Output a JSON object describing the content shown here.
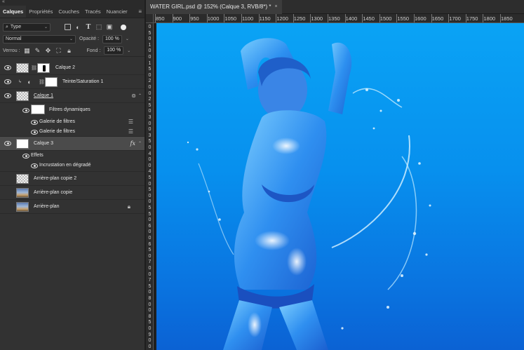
{
  "panel": {
    "collapse_glyph": "«",
    "tabs": [
      "Calques",
      "Propriétés",
      "Couches",
      "Tracés",
      "Nuancier"
    ],
    "menu_glyph": "≡",
    "filter": {
      "type_label": "Type"
    },
    "blend": {
      "mode": "Normal",
      "opacity_label": "Opacité :",
      "opacity_value": "100 %"
    },
    "lock": {
      "label": "Verrou :",
      "fill_label": "Fond :",
      "fill_value": "100 %"
    }
  },
  "layers": [
    {
      "name": "Calque 2",
      "visible": true,
      "thumb": "check",
      "mask": true
    },
    {
      "name": "Teinte/Saturation 1",
      "visible": true,
      "adjustment": true,
      "mask": true
    },
    {
      "name": "Calque 1",
      "visible": true,
      "smart": true,
      "underlined": true,
      "sub": [
        {
          "name": "Filtres dynamiques",
          "visible": true
        },
        {
          "name": "Galerie de filtres",
          "visible": true
        },
        {
          "name": "Galerie de filtres",
          "visible": true
        }
      ]
    },
    {
      "name": "Calque 3",
      "visible": true,
      "selected": true,
      "fx_glyph": "fx",
      "sub": [
        {
          "name": "Effets",
          "visible": true
        },
        {
          "name": "Incrustation en dégradé",
          "visible": true
        }
      ]
    },
    {
      "name": "Arrière-plan copie 2",
      "visible": false,
      "thumb": "check"
    },
    {
      "name": "Arrière-plan copie",
      "visible": false,
      "thumb": "photo"
    },
    {
      "name": "Arrière-plan",
      "visible": false,
      "thumb": "photo",
      "locked": true
    }
  ],
  "document": {
    "tab_title": "WATER GIRL.psd @ 152% (Calque 3, RVB/8*) *",
    "close_glyph": "×",
    "h_ruler": [
      "850",
      "900",
      "950",
      "1000",
      "1050",
      "1100",
      "1150",
      "1200",
      "1250",
      "1300",
      "1350",
      "1400",
      "1450",
      "1500",
      "1550",
      "1600",
      "1650",
      "1700",
      "1750",
      "1800",
      "1850"
    ],
    "v_ruler": [
      "0",
      "5",
      "0",
      "1",
      "0",
      "0",
      "1",
      "5",
      "0",
      "2",
      "0",
      "0",
      "2",
      "5",
      "0",
      "3",
      "0",
      "0",
      "3",
      "5",
      "0",
      "4",
      "0",
      "0",
      "4",
      "5",
      "0",
      "5",
      "0",
      "0",
      "5",
      "5",
      "0",
      "6",
      "0",
      "0",
      "6",
      "5",
      "0",
      "7",
      "0",
      "0",
      "7",
      "5",
      "0",
      "8",
      "0",
      "0",
      "8",
      "5",
      "0",
      "9",
      "0",
      "0"
    ],
    "canvas_bg_top": "#0aa3f5",
    "canvas_bg_bottom": "#0b62d4"
  }
}
